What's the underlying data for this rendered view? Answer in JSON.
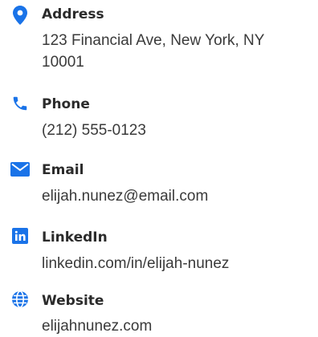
{
  "contact": {
    "accent_color": "#1a73e8",
    "items": [
      {
        "icon": "map-pin-icon",
        "label": "Address",
        "value": "123 Financial Ave, New York, NY 10001"
      },
      {
        "icon": "phone-icon",
        "label": "Phone",
        "value": "(212) 555-0123"
      },
      {
        "icon": "email-icon",
        "label": "Email",
        "value": "elijah.nunez@email.com"
      },
      {
        "icon": "linkedin-icon",
        "label": "LinkedIn",
        "value": "linkedin.com/in/elijah-nunez"
      },
      {
        "icon": "globe-icon",
        "label": "Website",
        "value": "elijahnunez.com"
      }
    ]
  }
}
